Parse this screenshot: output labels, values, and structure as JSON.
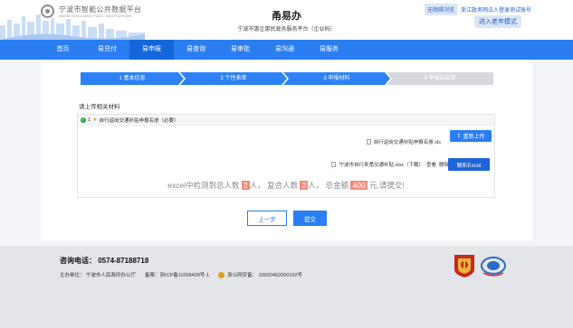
{
  "header": {
    "logo_cn": "宁波市智能公共数据平台",
    "logo_en": "NINGBO INTELLIGENT PUBLIC DATA PLATFORM",
    "title": "甬易办",
    "subtitle": "宁波市惠企惠民政务服务平台（企业码）",
    "accessibility_label": "无障碍浏览",
    "login_label": "浙江政务网法人登录测试账号",
    "elder_mode_label": "进入老年模式"
  },
  "nav": {
    "items": [
      {
        "label": "首页",
        "active": false
      },
      {
        "label": "易兑付",
        "active": false
      },
      {
        "label": "易申报",
        "active": true
      },
      {
        "label": "易查询",
        "active": false
      },
      {
        "label": "易审批",
        "active": false
      },
      {
        "label": "易沟通",
        "active": false
      },
      {
        "label": "易服务",
        "active": false
      }
    ]
  },
  "steps": [
    {
      "label": "1 基本信息",
      "done": true
    },
    {
      "label": "2 个性表单",
      "done": true
    },
    {
      "label": "3 申报材料",
      "done": true
    },
    {
      "label": "4 申报告知单",
      "done": false
    }
  ],
  "upload": {
    "title": "请上传相关材料",
    "material_index": "1",
    "material_name": "自行返岗交通补贴申报名册（必要）",
    "uploaded_file": "自行返岗交通补贴申报名册.xls",
    "reupload_label": "重新上传",
    "template_file": "宁波市自行来甬交通补贴.xlsx（下载）",
    "view_label": "查看",
    "delete_label": "删除",
    "parse_label": "解析Excel",
    "result": {
      "prefix": "excel中检测到总人数",
      "total_people": "2",
      "mid1": "人，",
      "mid2": "复合人数",
      "valid_people": "2",
      "mid3": "人，",
      "mid4": "总金额",
      "amount": "400",
      "suffix": "元,请提交!"
    }
  },
  "actions": {
    "prev_label": "上一步",
    "submit_label": "提交"
  },
  "footer": {
    "hotline": "咨询电话：  0574-87188718",
    "host": "主办单位：  宁波市人民政府办公厅",
    "icp": "备案：浙ICP备11058409号-1",
    "police": "浙公网安备：  33020402000102号"
  },
  "colors": {
    "primary": "#2a7ef2",
    "nav_active": "#1467da",
    "highlight": "#f08c7a"
  }
}
